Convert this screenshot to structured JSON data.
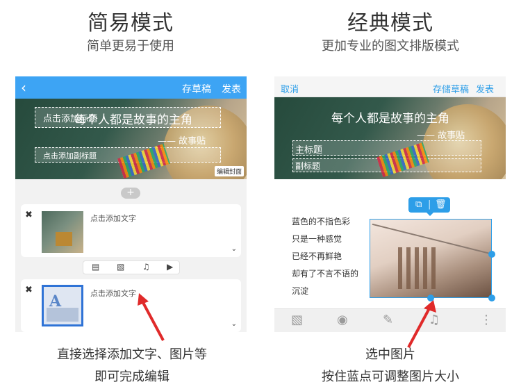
{
  "left": {
    "heading": "简易模式",
    "subheading": "简单更易于使用",
    "topbar": {
      "back_icon": "chevron-left-icon",
      "draft_label": "存草稿",
      "publish_label": "发表"
    },
    "cover": {
      "title_placeholder": "点击添加标题",
      "overlay_text": "每个人都是故事的主角",
      "sign_text": "—— 故事贴",
      "subtitle_placeholder": "点击添加副标题",
      "edit_cover_label": "编辑封面"
    },
    "plus_label": "+",
    "cards": [
      {
        "close": "✖",
        "text": "点击添加文字",
        "chevron": "⌄"
      },
      {
        "close": "✖",
        "text": "点击添加文字",
        "chevron": "⌄"
      }
    ],
    "insert_icons": [
      "file-icon",
      "image-icon",
      "music-icon",
      "video-icon"
    ],
    "caption_line1": "直接选择添加文字、图片等",
    "caption_line2": "即可完成编辑"
  },
  "right": {
    "heading": "经典模式",
    "subheading": "更加专业的图文排版模式",
    "topbar": {
      "cancel_label": "取消",
      "save_draft_label": "存储草稿",
      "publish_label": "发表"
    },
    "cover": {
      "overlay_text": "每个人都是故事的主角",
      "sign_text": "—— 故事贴",
      "title_label": "主标题",
      "subtitle_label": "副标题"
    },
    "poem_lines": [
      "蓝色的不指色彩",
      "只是一种感觉",
      "已经不再鲜艳",
      "却有了不言不语的",
      "沉淀"
    ],
    "photo_tools": [
      "crop-icon",
      "trash-icon"
    ],
    "bottom_tools": [
      "image-icon",
      "camera-icon",
      "edit-icon",
      "music-icon",
      "more-vertical-icon"
    ],
    "caption_line1": "选中图片",
    "caption_line2": "按住蓝点可调整图片大小"
  },
  "colors": {
    "accent": "#3da4f4",
    "link": "#2d9ee8",
    "arrow": "#e02a2a"
  }
}
